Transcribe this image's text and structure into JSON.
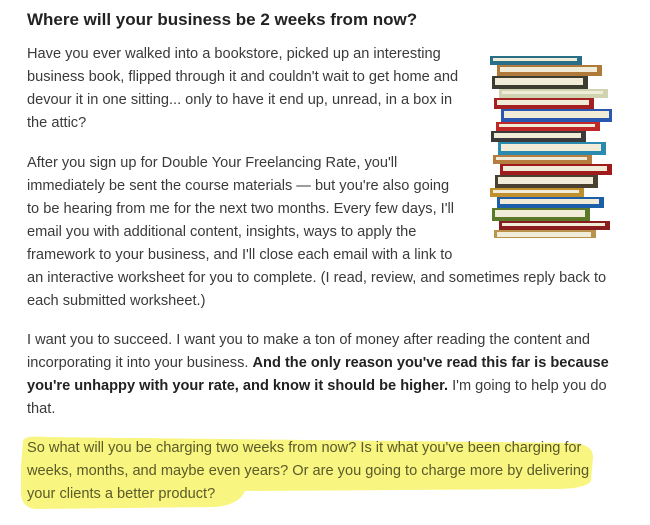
{
  "heading": "Where will your business be 2 weeks from now?",
  "paragraphs": [
    {
      "lines": [
        "Have you ever walked into a bookstore, picked up an interesting",
        "business book, flipped through it and couldn't wait to get home and",
        "devour it in one sitting... only to have it end up, unread, in a box in",
        "the attic?"
      ]
    },
    {
      "lines": [
        "After you sign up for Double Your Freelancing Rate, you'll",
        "immediately be sent the course materials — but you're also going",
        "to be hearing from me for the next two months. Every few days, I'll",
        "email you with additional content, insights, ways to apply the",
        "framework to your business, and I'll close each email with a link to",
        "an interactive worksheet for you to complete. (I read, review, and sometimes reply back to",
        "each submitted worksheet.)"
      ]
    },
    {
      "line1": "I want you to succeed. I want you to make a ton of money after reading the content and",
      "line2a": "incorporating it into your business. ",
      "line2b": "And the only reason you've read this far is because",
      "line3a": "you're unhappy with your rate, and know it should be higher.",
      "line3b": " I'm going to help you do",
      "line4": "that."
    },
    {
      "lines": [
        "So what will you be charging two weeks from now? Is it what you've been charging for",
        "weeks, months, and maybe even years? Or are you going to charge more by delivering",
        "your clients a better product?"
      ],
      "highlight_color": "#f7f36a"
    }
  ],
  "image": {
    "icon": "stack-of-books"
  }
}
